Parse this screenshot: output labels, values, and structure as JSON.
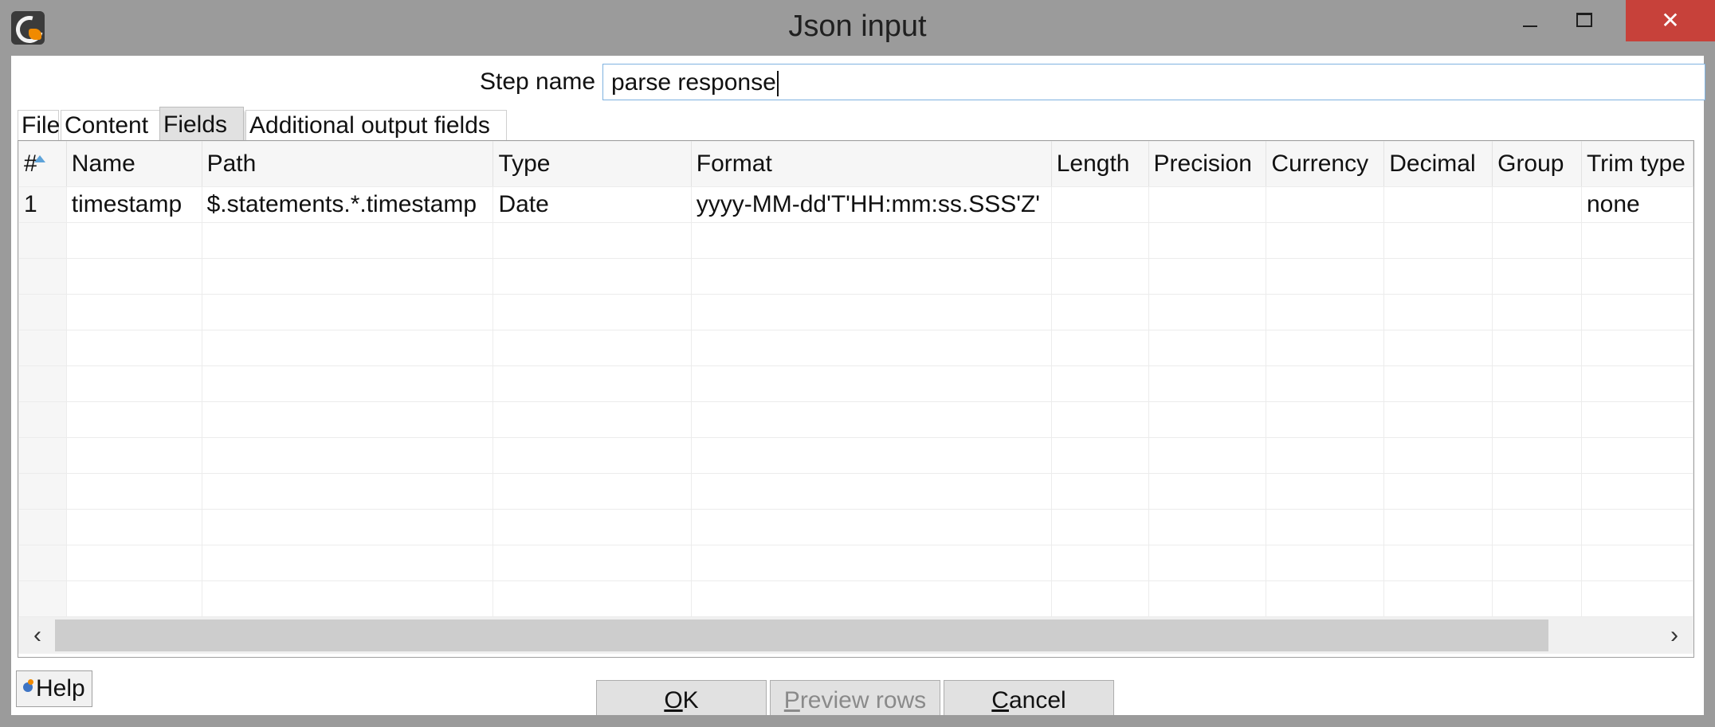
{
  "window": {
    "title": "Json input",
    "close_glyph": "✕",
    "icon": "pentaho-spoon-icon"
  },
  "step": {
    "label": "Step name",
    "value": "parse response"
  },
  "tabs": [
    {
      "label": "File",
      "active": false
    },
    {
      "label": "Content",
      "active": false
    },
    {
      "label": "Fields",
      "active": true
    },
    {
      "label": "Additional output fields",
      "active": false
    }
  ],
  "table": {
    "columns": [
      "#",
      "Name",
      "Path",
      "Type",
      "Format",
      "Length",
      "Precision",
      "Currency",
      "Decimal",
      "Group",
      "Trim type"
    ],
    "rows": [
      [
        "1",
        "timestamp",
        "$.statements.*.timestamp",
        "Date",
        "yyyy-MM-dd'T'HH:mm:ss.SSS'Z'",
        "",
        "",
        "",
        "",
        "",
        "none"
      ]
    ]
  },
  "scrollbar": {
    "left_glyph": "‹",
    "right_glyph": "›"
  },
  "buttons": {
    "help": "Help",
    "ok_mnemonic": "O",
    "ok_rest": "K",
    "preview_mnemonic": "P",
    "preview_rest": "review rows",
    "cancel_mnemonic": "C",
    "cancel_rest": "ancel"
  },
  "colors": {
    "titlebar": "#9b9b9b",
    "close_button": "#c7413a",
    "input_border": "#7fb2e0",
    "sort_indicator": "#5ea3d9"
  }
}
